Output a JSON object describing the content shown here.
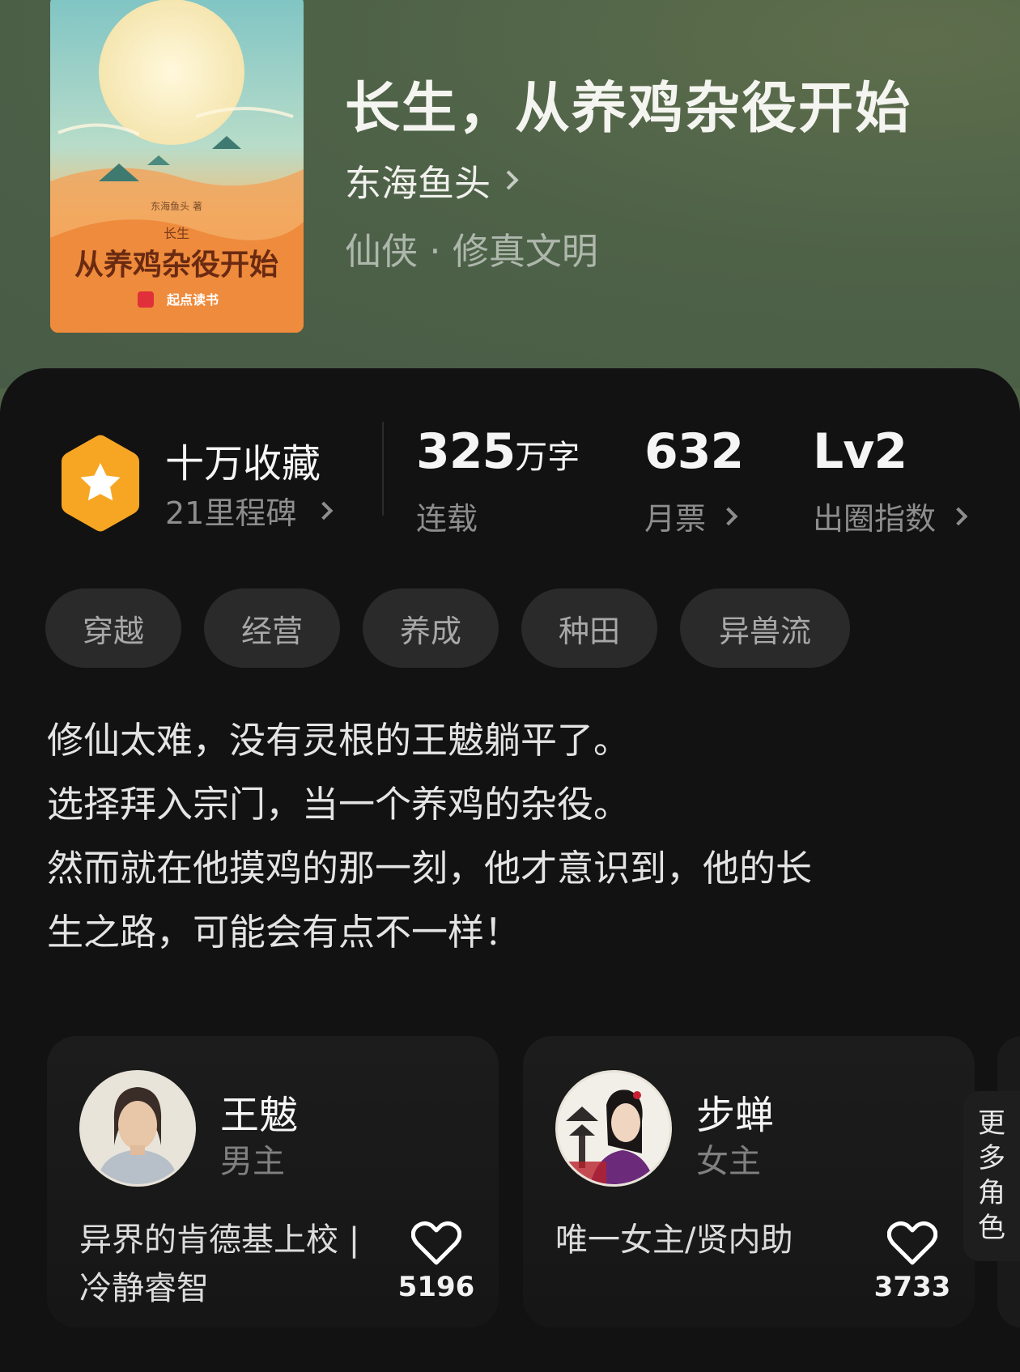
{
  "book": {
    "title": "长生，从养鸡杂役开始",
    "author": "东海鱼头",
    "genre": "仙侠 · 修真文明"
  },
  "cover": {
    "brand_small": "东海鱼头 著",
    "sub_title": "长生",
    "main_title": "从养鸡杂役开始",
    "publisher": "起点读书"
  },
  "stats": {
    "collection": {
      "title": "十万收藏",
      "sub": "21里程碑"
    },
    "words": {
      "value": "325",
      "unit": "万字",
      "label": "连载"
    },
    "monthly_votes": {
      "value": "632",
      "label": "月票"
    },
    "breakout_index": {
      "value": "Lv2",
      "label": "出圈指数"
    }
  },
  "tags": [
    "穿越",
    "经营",
    "养成",
    "种田",
    "异兽流"
  ],
  "synopsis": [
    "修仙太难，没有灵根的王魃躺平了。",
    "选择拜入宗门，当一个养鸡的杂役。",
    "然而就在他摸鸡的那一刻，他才意识到，他的长",
    "生之路，可能会有点不一样！"
  ],
  "characters": [
    {
      "name": "王魃",
      "role": "男主",
      "desc_line1": "异界的肯德基上校 |",
      "desc_line2": "冷静睿智",
      "likes": "5196"
    },
    {
      "name": "步蝉",
      "role": "女主",
      "desc_line1": "",
      "desc_line2": "唯一女主/贤内助",
      "likes": "3733"
    }
  ],
  "more_characters": [
    "更",
    "多",
    "角",
    "色"
  ],
  "colors": {
    "badge": "#f7a623",
    "panel": "#121212",
    "tag_bg": "#2a2a2a"
  },
  "icons": [
    "star-badge-icon",
    "chevron-right-icon",
    "heart-icon"
  ]
}
